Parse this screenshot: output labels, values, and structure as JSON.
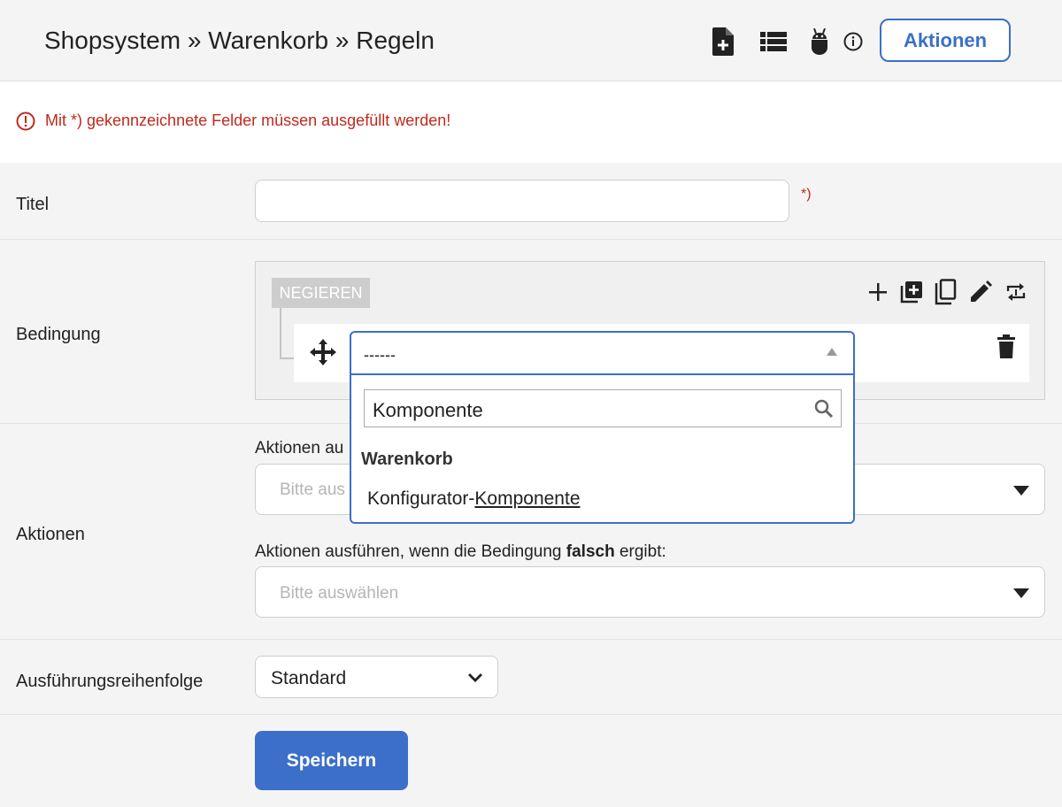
{
  "header": {
    "breadcrumb": "Shopsystem » Warenkorb » Regeln",
    "actions_label": "Aktionen"
  },
  "alert": {
    "message": "Mit *) gekennzeichnete Felder müssen ausgefüllt werden!"
  },
  "form": {
    "title": {
      "label": "Titel",
      "value": "",
      "required_marker": "*)"
    },
    "condition": {
      "label": "Bedingung",
      "negate_label": "NEGIEREN",
      "select_value": "------",
      "search_value": "Komponente",
      "group_label": "Warenkorb",
      "option_prefix": "Konfigurator-",
      "option_match": "Komponente"
    },
    "actions": {
      "label": "Aktionen",
      "true_label_visible": "Aktionen au",
      "true_placeholder_visible": "Bitte aus",
      "false_label_prefix": "Aktionen ausführen, wenn die Bedingung ",
      "false_label_bold": "falsch",
      "false_label_suffix": " ergibt:",
      "false_placeholder": "Bitte auswählen"
    },
    "order": {
      "label": "Ausführungsreihenfolge",
      "value": "Standard"
    },
    "save_label": "Speichern"
  },
  "colors": {
    "accent": "#3b6fc9",
    "error": "#c0291d",
    "background": "#f4f4f4"
  }
}
